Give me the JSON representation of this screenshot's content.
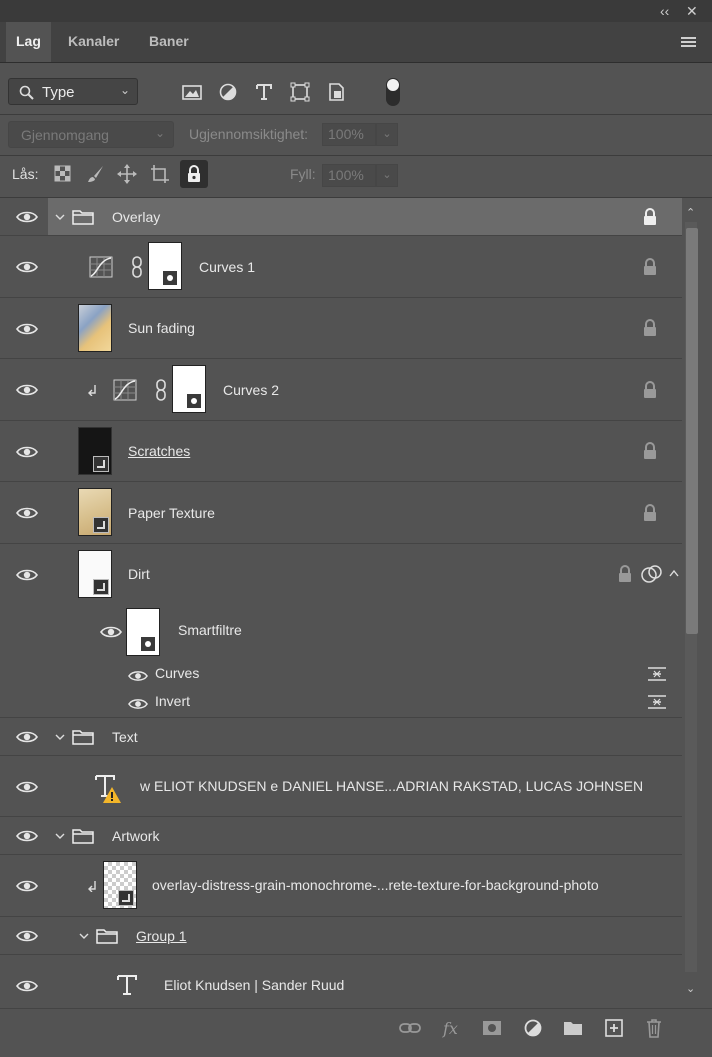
{
  "tabs": [
    {
      "label": "Lag",
      "active": true
    },
    {
      "label": "Kanaler",
      "active": false
    },
    {
      "label": "Baner",
      "active": false
    }
  ],
  "window_controls": {
    "collapse": "‹‹",
    "close": "✕"
  },
  "filter": {
    "type_label": "Type"
  },
  "blend": {
    "mode": "Gjennomgang",
    "opacity_label": "Ugjennomsiktighet:",
    "opacity_value": "100%"
  },
  "lock": {
    "label": "Lås:",
    "fill_label": "Fyll:",
    "fill_value": "100%"
  },
  "layers": [
    {
      "name": "Overlay",
      "kind": "group",
      "selected": true
    },
    {
      "name": "Curves 1",
      "kind": "adjustment"
    },
    {
      "name": "Sun fading",
      "kind": "pixel"
    },
    {
      "name": "Curves 2",
      "kind": "adjustment",
      "clipped": true
    },
    {
      "name": "Scratches ",
      "kind": "smart"
    },
    {
      "name": "Paper Texture",
      "kind": "smart"
    },
    {
      "name": "Dirt",
      "kind": "smart"
    },
    {
      "name": "Smartfiltre",
      "kind": "smartfilter"
    },
    {
      "name": "Curves",
      "kind": "filter"
    },
    {
      "name": "Invert",
      "kind": "filter"
    },
    {
      "name": "Text",
      "kind": "group"
    },
    {
      "name": "w ELIOT KNUDSEN e DANIEL HANSE...ADRIAN RAKSTAD, LUCAS JOHNSEN",
      "kind": "text-warning"
    },
    {
      "name": "Artwork",
      "kind": "group"
    },
    {
      "name": "overlay-distress-grain-monochrome-...rete-texture-for-background-photo",
      "kind": "smart"
    },
    {
      "name": "Group 1 ",
      "kind": "group"
    },
    {
      "name": "Eliot Knudsen | Sander Ruud",
      "kind": "text"
    }
  ],
  "footer_icons": [
    "link-icon",
    "fx-icon",
    "mask-icon",
    "adjustment-icon",
    "folder-icon",
    "new-layer-icon",
    "trash-icon"
  ],
  "colors": {
    "panel": "#535353",
    "selected_row": "#6b6b6b",
    "tabbar": "#424242"
  }
}
